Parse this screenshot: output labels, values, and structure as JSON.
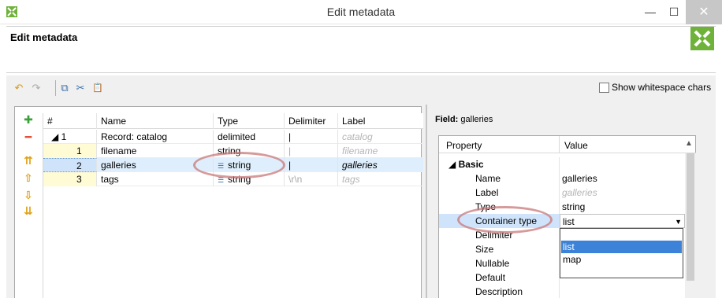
{
  "window": {
    "title": "Edit metadata",
    "minimize": "—",
    "maximize": "☐",
    "close": "✕"
  },
  "header": {
    "title": "Edit metadata"
  },
  "toolbar": {
    "undo_icon": "↶",
    "redo_icon": "↷",
    "copy_icon": "⧉",
    "cut_icon": "✂",
    "paste_icon": "📋",
    "whitespace_label": "Show whitespace chars",
    "whitespace_checked": false
  },
  "side_tools": {
    "add": "✚",
    "remove": "━",
    "move_top": "⇈",
    "move_up": "⇧",
    "move_down": "⇩",
    "move_bottom": "⇊"
  },
  "grid": {
    "columns": [
      "#",
      "Name",
      "Type",
      "Delimiter",
      "Label"
    ],
    "rows": [
      {
        "num": "◢ 1",
        "name": "Record: catalog",
        "type": "delimited",
        "delimiter": "|",
        "label": "catalog"
      },
      {
        "num": "1",
        "name": "filename",
        "type": "string",
        "delimiter": "|",
        "label": "filename"
      },
      {
        "num": "2",
        "name": "galleries",
        "type": "string",
        "delimiter": "|",
        "label": "galleries"
      },
      {
        "num": "3",
        "name": "tags",
        "type": "string",
        "delimiter": "\\r\\n",
        "label": "tags"
      }
    ]
  },
  "field_panel": {
    "title_prefix": "Field:",
    "title_value": "galleries",
    "columns": [
      "Property",
      "Value"
    ],
    "basic_label": "◢ Basic",
    "properties": [
      {
        "name": "Name",
        "value": "galleries"
      },
      {
        "name": "Label",
        "value": "galleries"
      },
      {
        "name": "Type",
        "value": "string"
      },
      {
        "name": "Container type",
        "value": "list"
      },
      {
        "name": "Delimiter",
        "value": ""
      },
      {
        "name": "Size",
        "value": ""
      },
      {
        "name": "Nullable",
        "value": ""
      },
      {
        "name": "Default",
        "value": ""
      },
      {
        "name": "Description",
        "value": ""
      }
    ],
    "dropdown_options": [
      "list",
      "map"
    ],
    "dropdown_selected": "list"
  },
  "colors": {
    "accent_green": "#6fb23a",
    "selection_blue": "#3b82d8",
    "highlight_oval": "#c9787a"
  }
}
